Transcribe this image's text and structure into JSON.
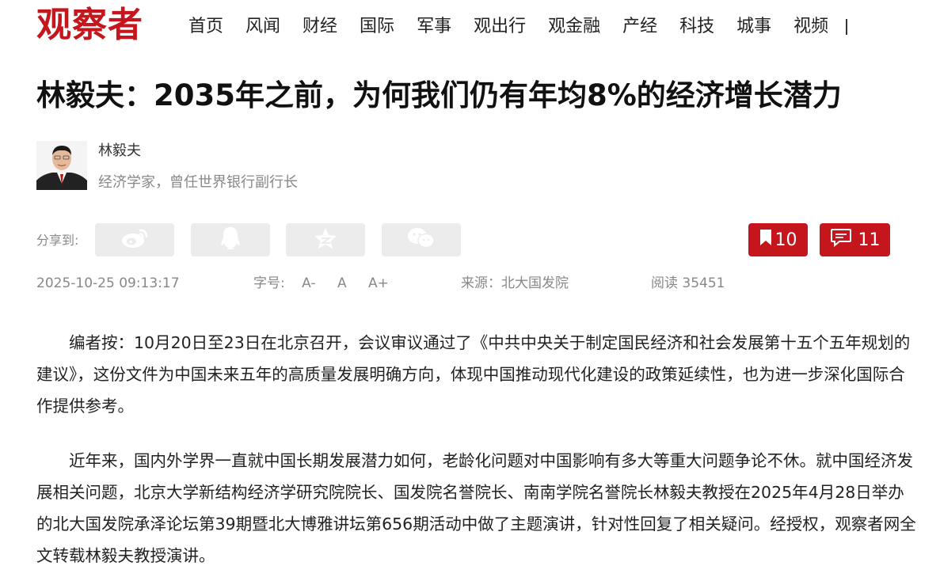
{
  "header": {
    "logo": "观察者",
    "nav": [
      "首页",
      "风闻",
      "财经",
      "国际",
      "军事",
      "观出行",
      "观金融",
      "产经",
      "科技",
      "城事",
      "视频"
    ]
  },
  "article": {
    "title": "林毅夫：2035年之前，为何我们仍有年均8%的经济增长潜力",
    "author": {
      "name": "林毅夫",
      "desc": "经济学家，曾任世界银行副行长"
    },
    "share_label": "分享到:",
    "bookmark_count": "10",
    "comment_count": "11",
    "date": "2025-10-25 09:13:17",
    "font_label": "字号:",
    "font_small": "A-",
    "font_normal": "A",
    "font_large": "A+",
    "source": "来源：北大国发院",
    "reads": "阅读 35451",
    "paragraphs": [
      "编者按：10月20日至23日在北京召开，会议审议通过了《中共中央关于制定国民经济和社会发展第十五个五年规划的建议》，这份文件为中国未来五年的高质量发展明确方向，体现中国推动现代化建设的政策延续性，也为进一步深化国际合作提供参考。",
      "近年来，国内外学界一直就中国长期发展潜力如何，老龄化问题对中国影响有多大等重大问题争论不休。就中国经济发展相关问题，北京大学新结构经济学研究院院长、国发院名誉院长、南南学院名誉院长林毅夫教授在2025年4月28日举办的北大国发院承泽论坛第39期暨北大博雅讲坛第656期活动中做了主题演讲，针对性回复了相关疑问。经授权，观察者网全文转载林毅夫教授演讲。"
    ]
  },
  "colors": {
    "brand": "#c4161c",
    "muted": "#888888",
    "share_bg": "#ececec"
  },
  "icons": [
    "weibo-icon",
    "qq-icon",
    "qzone-icon",
    "wechat-icon",
    "bookmark-icon",
    "comment-icon"
  ]
}
